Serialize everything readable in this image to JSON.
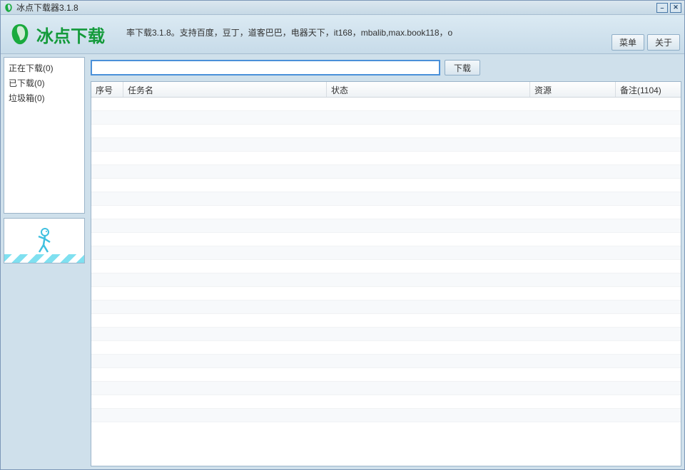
{
  "titlebar": {
    "title": "冰点下载器3.1.8"
  },
  "header": {
    "logo_text": "冰点下载",
    "info_text": "率下载3.1.8。支持百度，豆丁，道客巴巴，电器天下，it168，mbalib,max.book118，o",
    "menu_btn": "菜单",
    "about_btn": "关于"
  },
  "sidebar": {
    "items": [
      {
        "label": "正在下载(0)"
      },
      {
        "label": "已下载(0)"
      },
      {
        "label": "垃圾箱(0)"
      }
    ]
  },
  "url_row": {
    "input_value": "",
    "download_btn": "下载"
  },
  "table": {
    "columns": {
      "seq": "序号",
      "name": "任务名",
      "status": "状态",
      "resource": "资源",
      "note": "备注(1104)"
    }
  }
}
